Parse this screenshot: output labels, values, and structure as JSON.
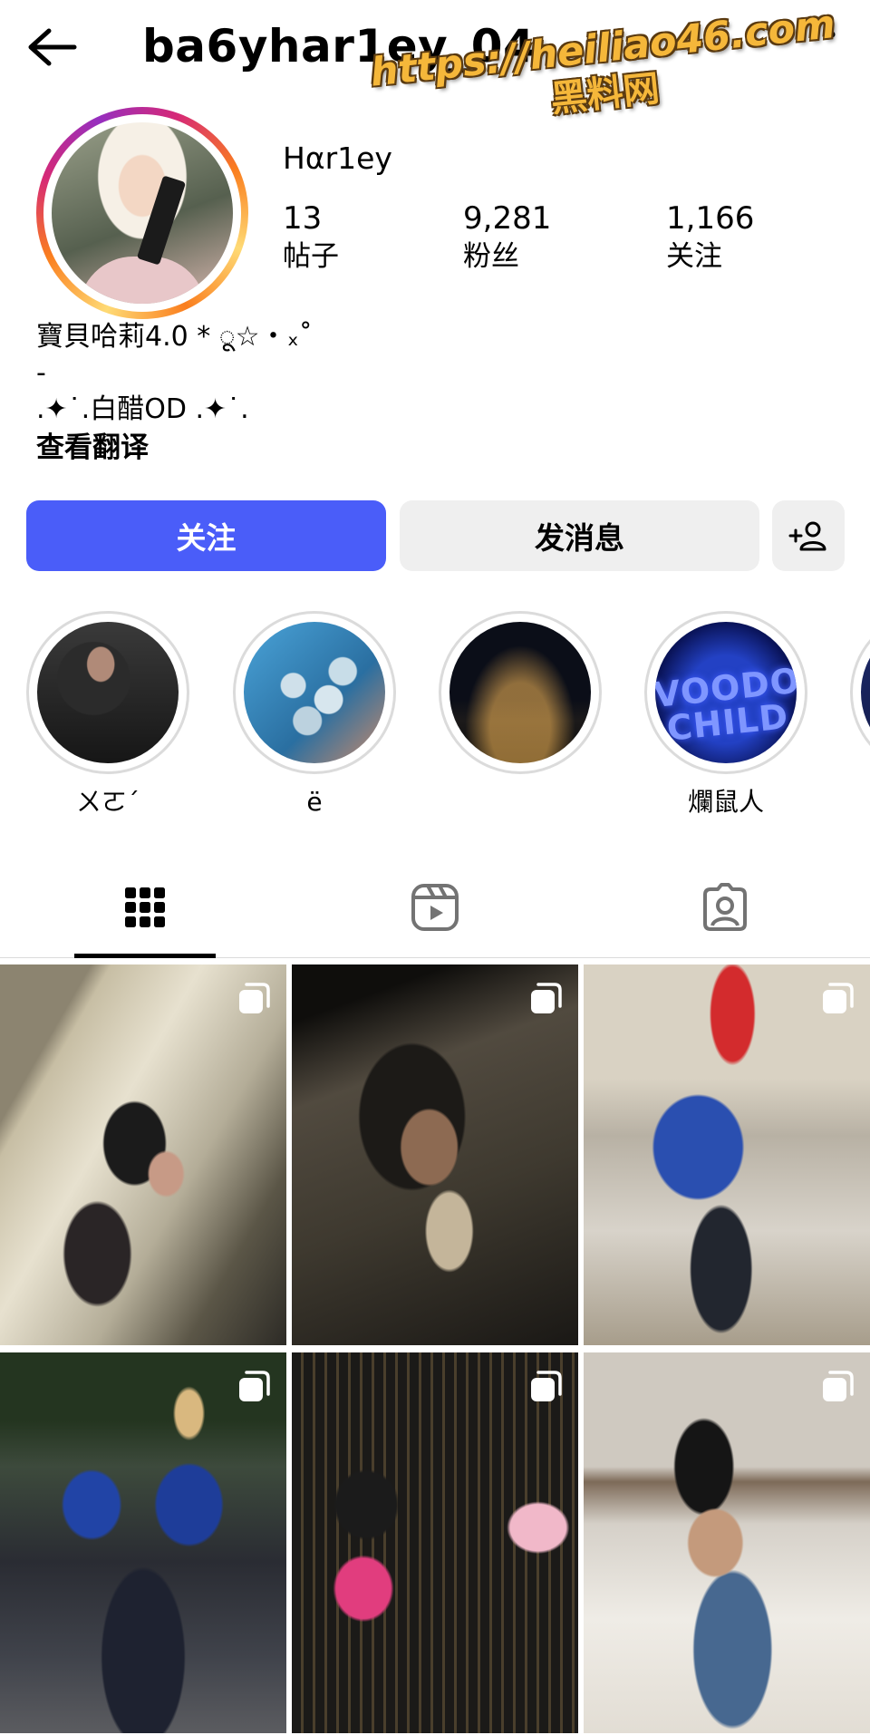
{
  "header": {
    "username": "ba6yhar1ey_04"
  },
  "watermark": {
    "url": "https://heiliao46.com",
    "name": "黑料网"
  },
  "profile": {
    "display_name": "H⍺r1ey",
    "posts_count": "13",
    "posts_label": "帖子",
    "followers_count": "9,281",
    "followers_label": "粉丝",
    "following_count": "1,166",
    "following_label": "关注"
  },
  "bio": {
    "line1": "寶貝哈莉4.0 * ू☆・ₓ˚",
    "line2": "-",
    "line3": ".✦˙.白醋OD .✦˙.",
    "translate_label": "查看翻译"
  },
  "actions": {
    "follow_label": "关注",
    "message_label": "发消息"
  },
  "highlights": [
    {
      "label": "ㄨㄛˊ"
    },
    {
      "label": "ë"
    },
    {
      "label": ""
    },
    {
      "label": "爛鼠人"
    },
    {
      "label": ""
    }
  ],
  "highlight_texts": {
    "voodoo": "VOODOO CHILD"
  },
  "tabs": {
    "active": "posts-grid"
  }
}
